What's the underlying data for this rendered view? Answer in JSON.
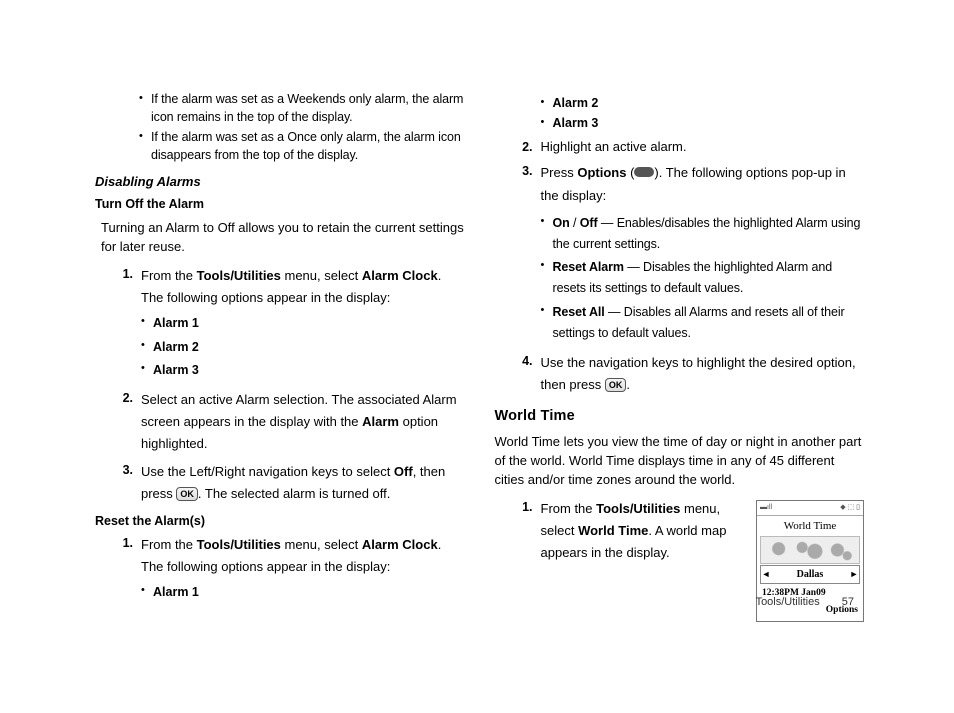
{
  "left": {
    "topBullets": [
      "If the alarm was set as a Weekends only alarm, the alarm icon remains in the top of the display.",
      "If the alarm was set as a Once only alarm, the alarm icon disappears from the top of the display."
    ],
    "disablingHeading": "Disabling Alarms",
    "turnOffHeading": "Turn Off the Alarm",
    "turnOffIntro": "Turning an Alarm to Off allows you to retain the current settings for later reuse.",
    "step1_prefix": "From the ",
    "step1_b1": "Tools/Utilities",
    "step1_mid": " menu, select ",
    "step1_b2": "Alarm Clock",
    "step1_suffix": ". The following options appear in the display:",
    "alarmList": [
      "Alarm 1",
      "Alarm 2",
      "Alarm 3"
    ],
    "step2_a": "Select an active Alarm selection. The associated Alarm screen appears in the display with the ",
    "step2_b": "Alarm",
    "step2_c": " option highlighted.",
    "step3_a": "Use the Left/Right navigation keys to select ",
    "step3_b": "Off",
    "step3_c": ", then press ",
    "step3_d": ". The selected alarm is turned off.",
    "resetHeading": "Reset the Alarm(s)",
    "rstep1_prefix": "From the ",
    "rstep1_b1": "Tools/Utilities",
    "rstep1_mid": " menu, select ",
    "rstep1_b2": "Alarm Clock",
    "rstep1_suffix": ". The following options appear in the display:",
    "rAlarmList1": "Alarm 1"
  },
  "right": {
    "contAlarms": [
      "Alarm 2",
      "Alarm 3"
    ],
    "step2": "Highlight an active alarm.",
    "step3_a": "Press ",
    "step3_b": "Options",
    "step3_c": " (",
    "step3_d": "). The following options pop-up in the display:",
    "opt1_b1": "On",
    "opt1_sep": " / ",
    "opt1_b2": "Off",
    "opt1_rest": " — Enables/disables the highlighted Alarm using the current settings.",
    "opt2_b": "Reset Alarm",
    "opt2_rest": " — Disables the highlighted Alarm and resets its settings to default values.",
    "opt3_b": "Reset All",
    "opt3_rest": " — Disables all Alarms and resets all of their settings to default values.",
    "step4_a": "Use the navigation keys to highlight the desired option, then press ",
    "step4_b": ".",
    "worldHeading": "World Time",
    "worldPara": "World Time lets you view the time of day or night in another part of the world. World Time displays time in any of 45 different cities and/or time zones around the world.",
    "wstep1_a": "From the ",
    "wstep1_b": "Tools/Utilities",
    "wstep1_c": " menu, select ",
    "wstep1_d": "World Time",
    "wstep1_e": ". A world map appears in the display.",
    "phone": {
      "title": "World Time",
      "city": "Dallas",
      "time": "12:38PM Jan09",
      "options": "Options"
    }
  },
  "footer": {
    "label": "Tools/Utilities",
    "page": "57"
  },
  "ok": "OK"
}
